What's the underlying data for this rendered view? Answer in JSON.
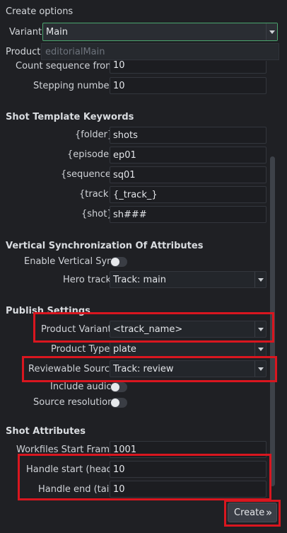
{
  "header": {
    "title": "Create options"
  },
  "variant": {
    "label": "Variant",
    "value": "Main"
  },
  "product": {
    "label": "Product",
    "value": "editorialMain"
  },
  "fields": {
    "count_sequence_from": {
      "label": "Count sequence from",
      "value": "10"
    },
    "stepping_number": {
      "label": "Stepping number",
      "value": "10"
    }
  },
  "shot_template": {
    "heading": "Shot Template Keywords",
    "folder": {
      "label": "{folder}",
      "value": "shots"
    },
    "episode": {
      "label": "{episode}",
      "value": "ep01"
    },
    "sequence": {
      "label": "{sequence}",
      "value": "sq01"
    },
    "track": {
      "label": "{track}",
      "value": "{_track_}"
    },
    "shot": {
      "label": "{shot}",
      "value": "sh###"
    }
  },
  "vertical_sync": {
    "heading": "Vertical Synchronization Of Attributes",
    "enable_label": "Enable Vertical Sync",
    "enabled": false,
    "hero_track": {
      "label": "Hero track",
      "value": "Track: main"
    }
  },
  "publish": {
    "heading": "Publish Settings",
    "product_variant": {
      "label": "Product Variant",
      "value": "<track_name>"
    },
    "product_type": {
      "label": "Product Type",
      "value": "plate"
    },
    "reviewable_source": {
      "label": "Reviewable Source",
      "value": "Track: review"
    },
    "include_audio": {
      "label": "Include audio",
      "enabled": false
    },
    "source_resolution": {
      "label": "Source resolution",
      "enabled": false
    }
  },
  "shot_attributes": {
    "heading": "Shot Attributes",
    "workfiles_start_frame": {
      "label": "Workfiles Start Frame",
      "value": "1001"
    },
    "handle_start": {
      "label": "Handle start (head)",
      "value": "10"
    },
    "handle_end": {
      "label": "Handle end (tail)",
      "value": "10"
    }
  },
  "footer": {
    "create_label": "Create",
    "create_icon": "chevrons-right-icon"
  },
  "colors": {
    "highlight_red": "#d9161f",
    "focus_green": "#4aa56e",
    "bg": "#1f2024"
  }
}
